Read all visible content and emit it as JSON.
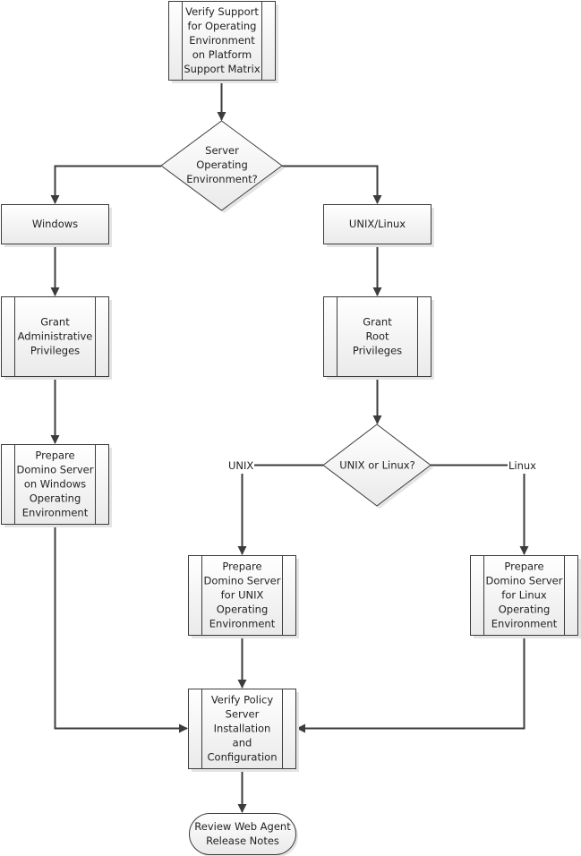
{
  "diagram": {
    "type": "flowchart",
    "colors": {
      "stroke": "#3c3c3c",
      "fill_top": "#ffffff",
      "fill_bottom": "#ebebeb",
      "shadow": "#e4e4e4",
      "text": "#222222"
    },
    "nodes": {
      "verify_support": {
        "shape": "predefined-process",
        "lines": [
          "Verify Support",
          "for Operating",
          "Environment",
          "on Platform",
          "Support Matrix"
        ]
      },
      "server_os": {
        "shape": "decision",
        "lines": [
          "Server",
          "Operating",
          "Environment?"
        ]
      },
      "windows": {
        "shape": "process",
        "lines": [
          "Windows"
        ]
      },
      "unix_linux": {
        "shape": "process",
        "lines": [
          "UNIX/Linux"
        ]
      },
      "grant_admin": {
        "shape": "predefined-process",
        "lines": [
          "Grant",
          "Administrative",
          "Privileges"
        ]
      },
      "grant_root": {
        "shape": "predefined-process",
        "lines": [
          "Grant",
          "Root",
          "Privileges"
        ]
      },
      "prepare_windows": {
        "shape": "predefined-process",
        "lines": [
          "Prepare",
          "Domino Server",
          "on Windows",
          "Operating",
          "Environment"
        ]
      },
      "unix_or_linux": {
        "shape": "decision",
        "lines": [
          "UNIX or Linux?"
        ]
      },
      "prepare_unix": {
        "shape": "predefined-process",
        "lines": [
          "Prepare",
          "Domino Server",
          "for UNIX",
          "Operating",
          "Environment"
        ]
      },
      "prepare_linux": {
        "shape": "predefined-process",
        "lines": [
          "Prepare",
          "Domino Server",
          "for Linux",
          "Operating",
          "Environment"
        ]
      },
      "verify_policy": {
        "shape": "predefined-process",
        "lines": [
          "Verify Policy",
          "Server",
          "Installation",
          "and",
          "Configuration"
        ]
      },
      "review_notes": {
        "shape": "terminator",
        "lines": [
          "Review Web Agent",
          "Release Notes"
        ]
      }
    },
    "edges": [
      {
        "from": "verify_support",
        "to": "server_os",
        "label": ""
      },
      {
        "from": "server_os",
        "to": "windows",
        "label": ""
      },
      {
        "from": "server_os",
        "to": "unix_linux",
        "label": ""
      },
      {
        "from": "windows",
        "to": "grant_admin",
        "label": ""
      },
      {
        "from": "unix_linux",
        "to": "grant_root",
        "label": ""
      },
      {
        "from": "grant_admin",
        "to": "prepare_windows",
        "label": ""
      },
      {
        "from": "grant_root",
        "to": "unix_or_linux",
        "label": ""
      },
      {
        "from": "unix_or_linux",
        "to": "prepare_unix",
        "label": "UNIX"
      },
      {
        "from": "unix_or_linux",
        "to": "prepare_linux",
        "label": "Linux"
      },
      {
        "from": "prepare_windows",
        "to": "verify_policy",
        "label": ""
      },
      {
        "from": "prepare_unix",
        "to": "verify_policy",
        "label": ""
      },
      {
        "from": "prepare_linux",
        "to": "verify_policy",
        "label": ""
      },
      {
        "from": "verify_policy",
        "to": "review_notes",
        "label": ""
      }
    ],
    "edge_labels": {
      "unix": "UNIX",
      "linux": "Linux"
    }
  }
}
